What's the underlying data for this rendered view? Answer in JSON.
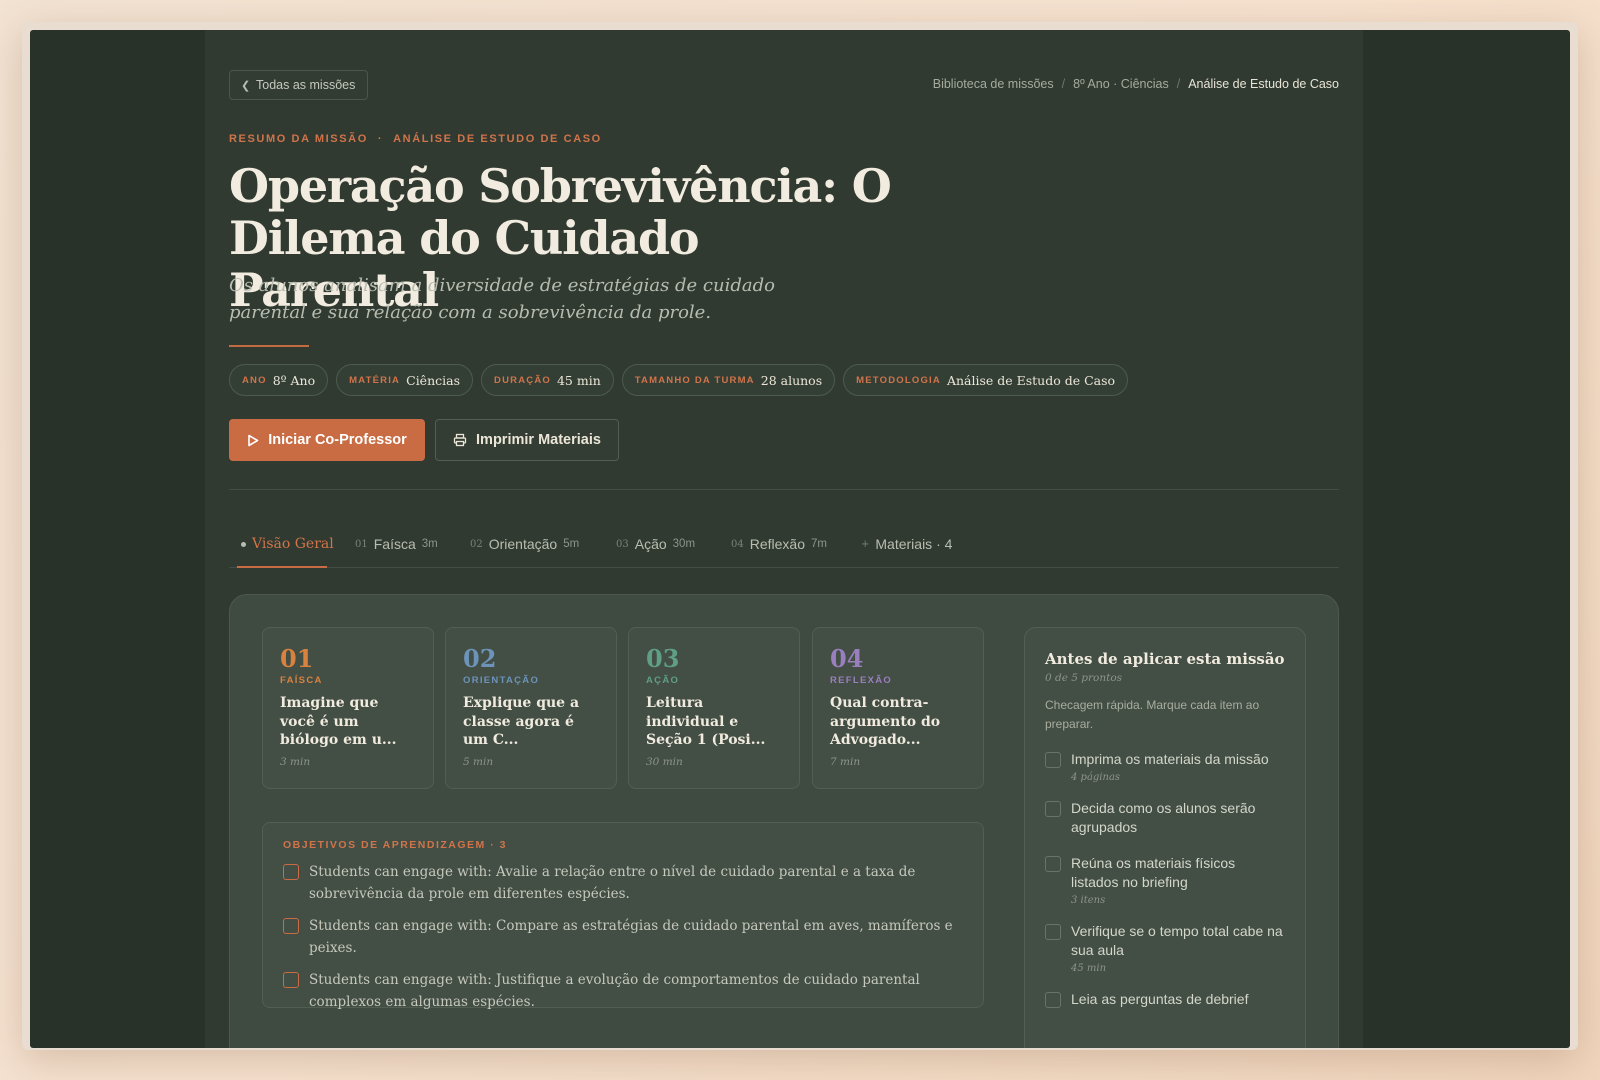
{
  "header": {
    "back_label": "Todas as missões",
    "breadcrumb": [
      "Biblioteca de missões",
      "8º Ano · Ciências",
      "Análise de Estudo de Caso"
    ]
  },
  "hero": {
    "eyebrow_1": "RESUMO DA MISSÃO",
    "eyebrow_sep": "·",
    "eyebrow_2": "ANÁLISE DE ESTUDO DE CASO",
    "title": "Operação Sobrevivência: O Dilema do Cuidado Parental",
    "subtitle": "Os alunos analisam a diversidade de estratégias de cuidado parental e sua relação com a sobrevivência da prole."
  },
  "meta": [
    {
      "key": "ANO",
      "value": "8º Ano"
    },
    {
      "key": "MATÉRIA",
      "value": "Ciências"
    },
    {
      "key": "DURAÇÃO",
      "value": "45 min"
    },
    {
      "key": "TAMANHO DA TURMA",
      "value": "28 alunos"
    },
    {
      "key": "METODOLOGIA",
      "value": "Análise de Estudo de Caso"
    }
  ],
  "actions": {
    "primary": "Iniciar Co-Professor",
    "secondary": "Imprimir Materiais"
  },
  "tabs": [
    {
      "num": "",
      "label": "Visão Geral",
      "dur": ""
    },
    {
      "num": "01",
      "label": "Faísca",
      "dur": "3m"
    },
    {
      "num": "02",
      "label": "Orientação",
      "dur": "5m"
    },
    {
      "num": "03",
      "label": "Ação",
      "dur": "30m"
    },
    {
      "num": "04",
      "label": "Reflexão",
      "dur": "7m"
    },
    {
      "num": "+",
      "label": "Materiais · 4",
      "dur": ""
    }
  ],
  "steps": [
    {
      "n": "01",
      "label": "FAÍSCA",
      "text": "Imagine que você é um biólogo em u...",
      "time": "3 min",
      "color": "#d9823f"
    },
    {
      "n": "02",
      "label": "ORIENTAÇÃO",
      "text": "Explique que a classe agora é um C...",
      "time": "5 min",
      "color": "#6c93b8"
    },
    {
      "n": "03",
      "label": "AÇÃO",
      "text": "Leitura individual e Seção 1 (Posi...",
      "time": "30 min",
      "color": "#5e9f86"
    },
    {
      "n": "04",
      "label": "REFLEXÃO",
      "text": "Qual contra-argumento do Advogado...",
      "time": "7 min",
      "color": "#9a7fbf"
    }
  ],
  "objectives": {
    "heading": "OBJETIVOS DE APRENDIZAGEM · 3",
    "items": [
      "Students can engage with: Avalie a relação entre o nível de cuidado parental e a taxa de sobrevivência da prole em diferentes espécies.",
      "Students can engage with: Compare as estratégias de cuidado parental em aves, mamíferos e peixes.",
      "Students can engage with: Justifique a evolução de comportamentos de cuidado parental complexos em algumas espécies."
    ]
  },
  "checklist": {
    "heading": "Antes de aplicar esta missão",
    "progress": "0 de 5 prontos",
    "description": "Checagem rápida. Marque cada item ao preparar.",
    "items": [
      {
        "text": "Imprima os materiais da missão",
        "meta": "4 páginas"
      },
      {
        "text": "Decida como os alunos serão agrupados",
        "meta": ""
      },
      {
        "text": "Reúna os materiais físicos listados no briefing",
        "meta": "3 itens"
      },
      {
        "text": "Verifique se o tempo total cabe na sua aula",
        "meta": "45 min"
      },
      {
        "text": "Leia as perguntas de debrief",
        "meta": ""
      }
    ]
  }
}
